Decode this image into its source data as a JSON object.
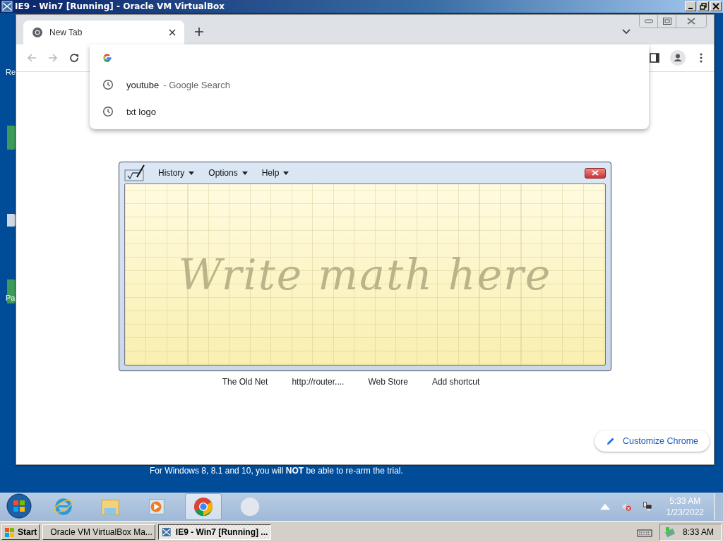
{
  "host_window": {
    "title": "IE9 - Win7 [Running] - Oracle VM VirtualBox"
  },
  "desktop": {
    "icon_labels": [
      "Re",
      "Pa"
    ],
    "notice": "For Windows 8, 8.1 and 10, you will **NOT** be able to re-arm the trial."
  },
  "browser": {
    "tabs": [
      {
        "title": "New Tab",
        "selected": true
      }
    ],
    "omnibox": {
      "suggestions": [
        {
          "text": "youtube",
          "hint": "- Google Search"
        },
        {
          "text": "txt logo"
        }
      ]
    },
    "shortcuts": [
      "The Old Net",
      "http://router....",
      "Web Store",
      "Add shortcut"
    ],
    "customize_button": "Customize Chrome"
  },
  "math_panel": {
    "menus": [
      "History",
      "Options",
      "Help"
    ],
    "placeholder": "Write math here"
  },
  "guest_taskbar": {
    "pinned": [
      {
        "kind": "ie",
        "selected": false
      },
      {
        "kind": "explorer",
        "selected": false
      },
      {
        "kind": "media",
        "selected": false
      },
      {
        "kind": "chrome",
        "selected": true
      },
      {
        "kind": "blank",
        "selected": false
      }
    ],
    "time": "5:33 AM",
    "date": "1/23/2022"
  },
  "host_taskbar": {
    "start": "Start",
    "tasks": [
      {
        "kind": "vbox",
        "label": "Oracle VM VirtualBox Ma...",
        "selected": false
      },
      {
        "kind": "vm",
        "label": "IE9 - Win7 [Running] ...",
        "selected": true
      }
    ],
    "time": "8:33 AM"
  }
}
